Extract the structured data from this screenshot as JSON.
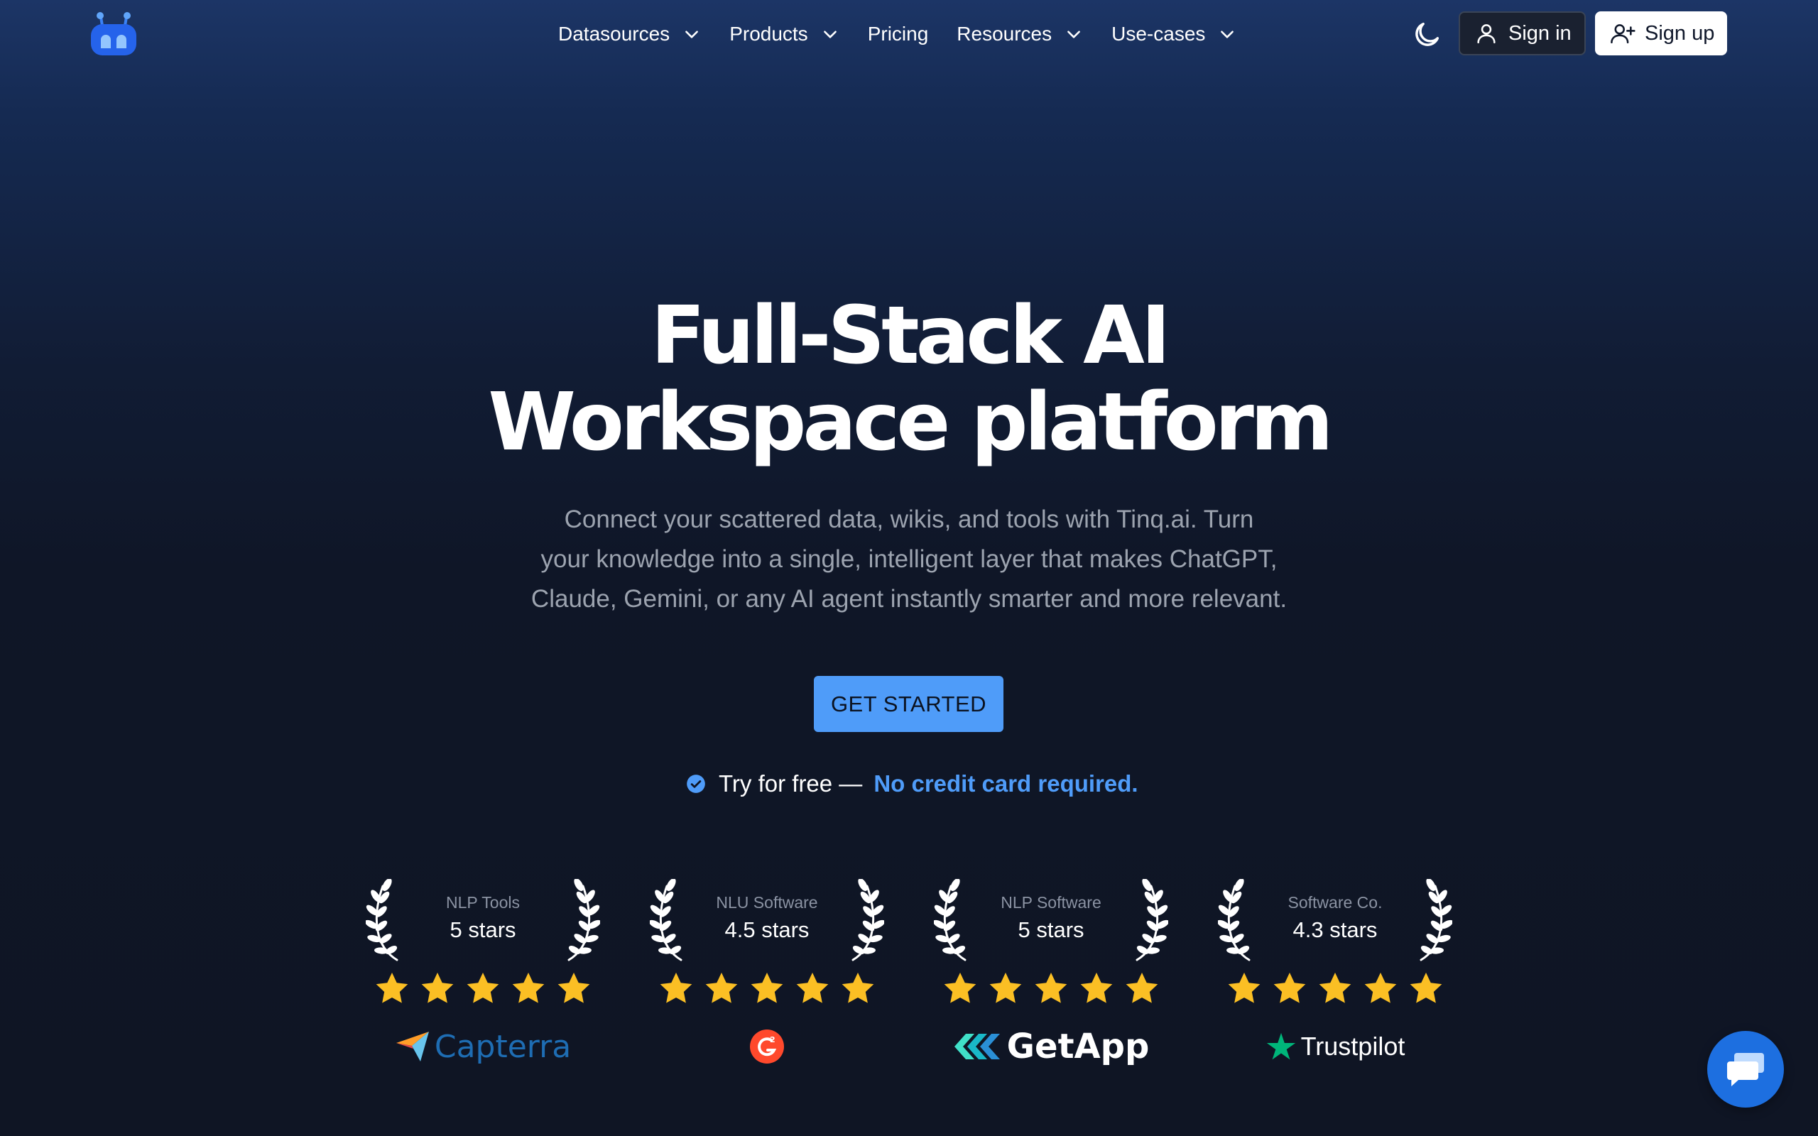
{
  "nav": {
    "items": [
      {
        "label": "Datasources",
        "has_dropdown": true
      },
      {
        "label": "Products",
        "has_dropdown": true
      },
      {
        "label": "Pricing",
        "has_dropdown": false
      },
      {
        "label": "Resources",
        "has_dropdown": true
      },
      {
        "label": "Use-cases",
        "has_dropdown": true
      }
    ],
    "theme_icon": "moon-icon",
    "signin_label": "Sign in",
    "signup_label": "Sign up"
  },
  "hero": {
    "title_line1": "Full-Stack AI",
    "title_line2": "Workspace platform",
    "subtitle_line1": "Connect your scattered data, wikis, and tools with Tinq.ai. Turn",
    "subtitle_line2": "your knowledge into a single, intelligent layer that makes ChatGPT,",
    "subtitle_line3": "Claude, Gemini, or any AI agent instantly smarter and more relevant.",
    "cta_label": "GET STARTED",
    "free_text": "Try for free —",
    "free_link": "No credit card required."
  },
  "awards": [
    {
      "category": "NLP Tools",
      "rating": "5 stars",
      "stars": 5,
      "brand": "Capterra"
    },
    {
      "category": "NLU Software",
      "rating": "4.5 stars",
      "stars": 5,
      "brand": "G2"
    },
    {
      "category": "NLP Software",
      "rating": "5 stars",
      "stars": 5,
      "brand": "GetApp"
    },
    {
      "category": "Software Co.",
      "rating": "4.3 stars",
      "stars": 5,
      "brand": "Trustpilot"
    }
  ],
  "colors": {
    "accent": "#4f9cf9",
    "star": "#fbbf24",
    "chat_button": "#1d6fe0"
  },
  "chat_icon": "chat-bubble-icon"
}
